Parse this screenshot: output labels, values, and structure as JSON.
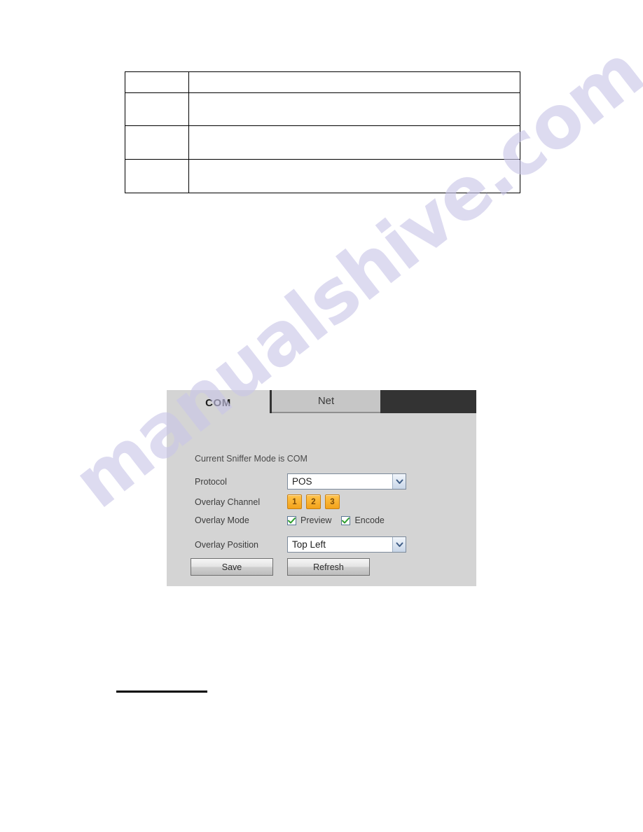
{
  "document": {
    "table": {
      "rows": [
        {
          "cells": [
            "",
            ""
          ]
        },
        {
          "cells": [
            "",
            ""
          ]
        },
        {
          "cells": [
            "",
            ""
          ]
        },
        {
          "cells": [
            "",
            ""
          ]
        }
      ]
    },
    "watermark": "manualshive.com"
  },
  "panel": {
    "tabs": [
      {
        "label": "COM",
        "active": true
      },
      {
        "label": "Net",
        "active": false
      }
    ],
    "note": "Current Sniffer Mode is COM",
    "fields": {
      "protocol": {
        "label": "Protocol",
        "value": "POS"
      },
      "overlay_channel": {
        "label": "Overlay Channel",
        "channels": [
          "1",
          "2",
          "3"
        ]
      },
      "overlay_mode": {
        "label": "Overlay Mode",
        "options": [
          {
            "label": "Preview",
            "checked": true
          },
          {
            "label": "Encode",
            "checked": true
          }
        ]
      },
      "overlay_position": {
        "label": "Overlay Position",
        "value": "Top Left"
      }
    },
    "buttons": {
      "save": "Save",
      "refresh": "Refresh"
    }
  },
  "colors": {
    "panel_bg": "#d4d4d4",
    "tab_bar": "#333333",
    "chip": "#f3a31a",
    "check": "#2f9e2f"
  }
}
